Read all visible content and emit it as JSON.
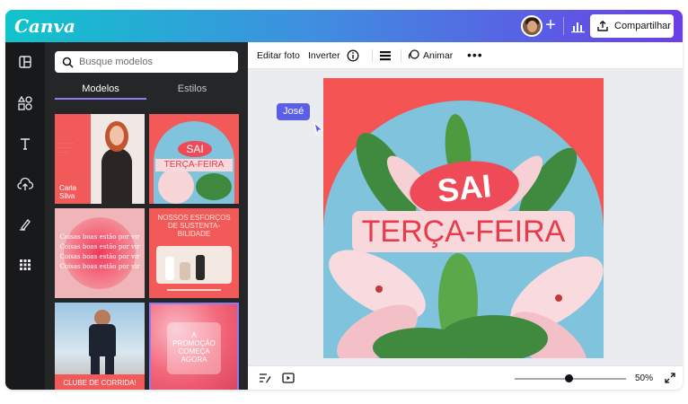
{
  "app": {
    "logo": "Canva",
    "share_label": "Compartilhar"
  },
  "search": {
    "placeholder": "Busque modelos"
  },
  "tabs": [
    {
      "label": "Modelos"
    },
    {
      "label": "Estilos"
    }
  ],
  "sidebar": {
    "items": [
      {
        "icon": "layout-icon"
      },
      {
        "icon": "elements-icon"
      },
      {
        "icon": "text-icon"
      },
      {
        "icon": "upload-icon"
      },
      {
        "icon": "draw-icon"
      },
      {
        "icon": "apps-icon"
      }
    ]
  },
  "templates": [
    {
      "name_line1": "Carla",
      "name_line2": "Silva"
    },
    {
      "line1": "SAI",
      "line2": "TERÇA-FEIRA"
    },
    {
      "text": "Coisas boas estão por vir"
    },
    {
      "line1": "NOSSOS ESFORÇOS",
      "line2": "DE SUSTENTA-",
      "line3": "BILIDADE"
    },
    {
      "text": "CLUBE DE CORRIDA!"
    },
    {
      "line1": "A",
      "line2": "PROMOÇÃO",
      "line3": "COMEÇA",
      "line4": "AGORA"
    }
  ],
  "toolbar": {
    "edit_photo": "Editar foto",
    "flip": "Inverter",
    "animate": "Animar"
  },
  "design": {
    "line1": "SAI",
    "line2": "TERÇA-FEIRA"
  },
  "collaborator": {
    "name": "José"
  },
  "zoom": {
    "label": "50%",
    "value": 50
  },
  "colors": {
    "accent": "#8b7cf6",
    "design_bg": "#f45454",
    "sky": "#7fc4dc",
    "pill": "#ef4a57",
    "banner": "#f9d8dc",
    "text_red": "#e83a4a"
  }
}
